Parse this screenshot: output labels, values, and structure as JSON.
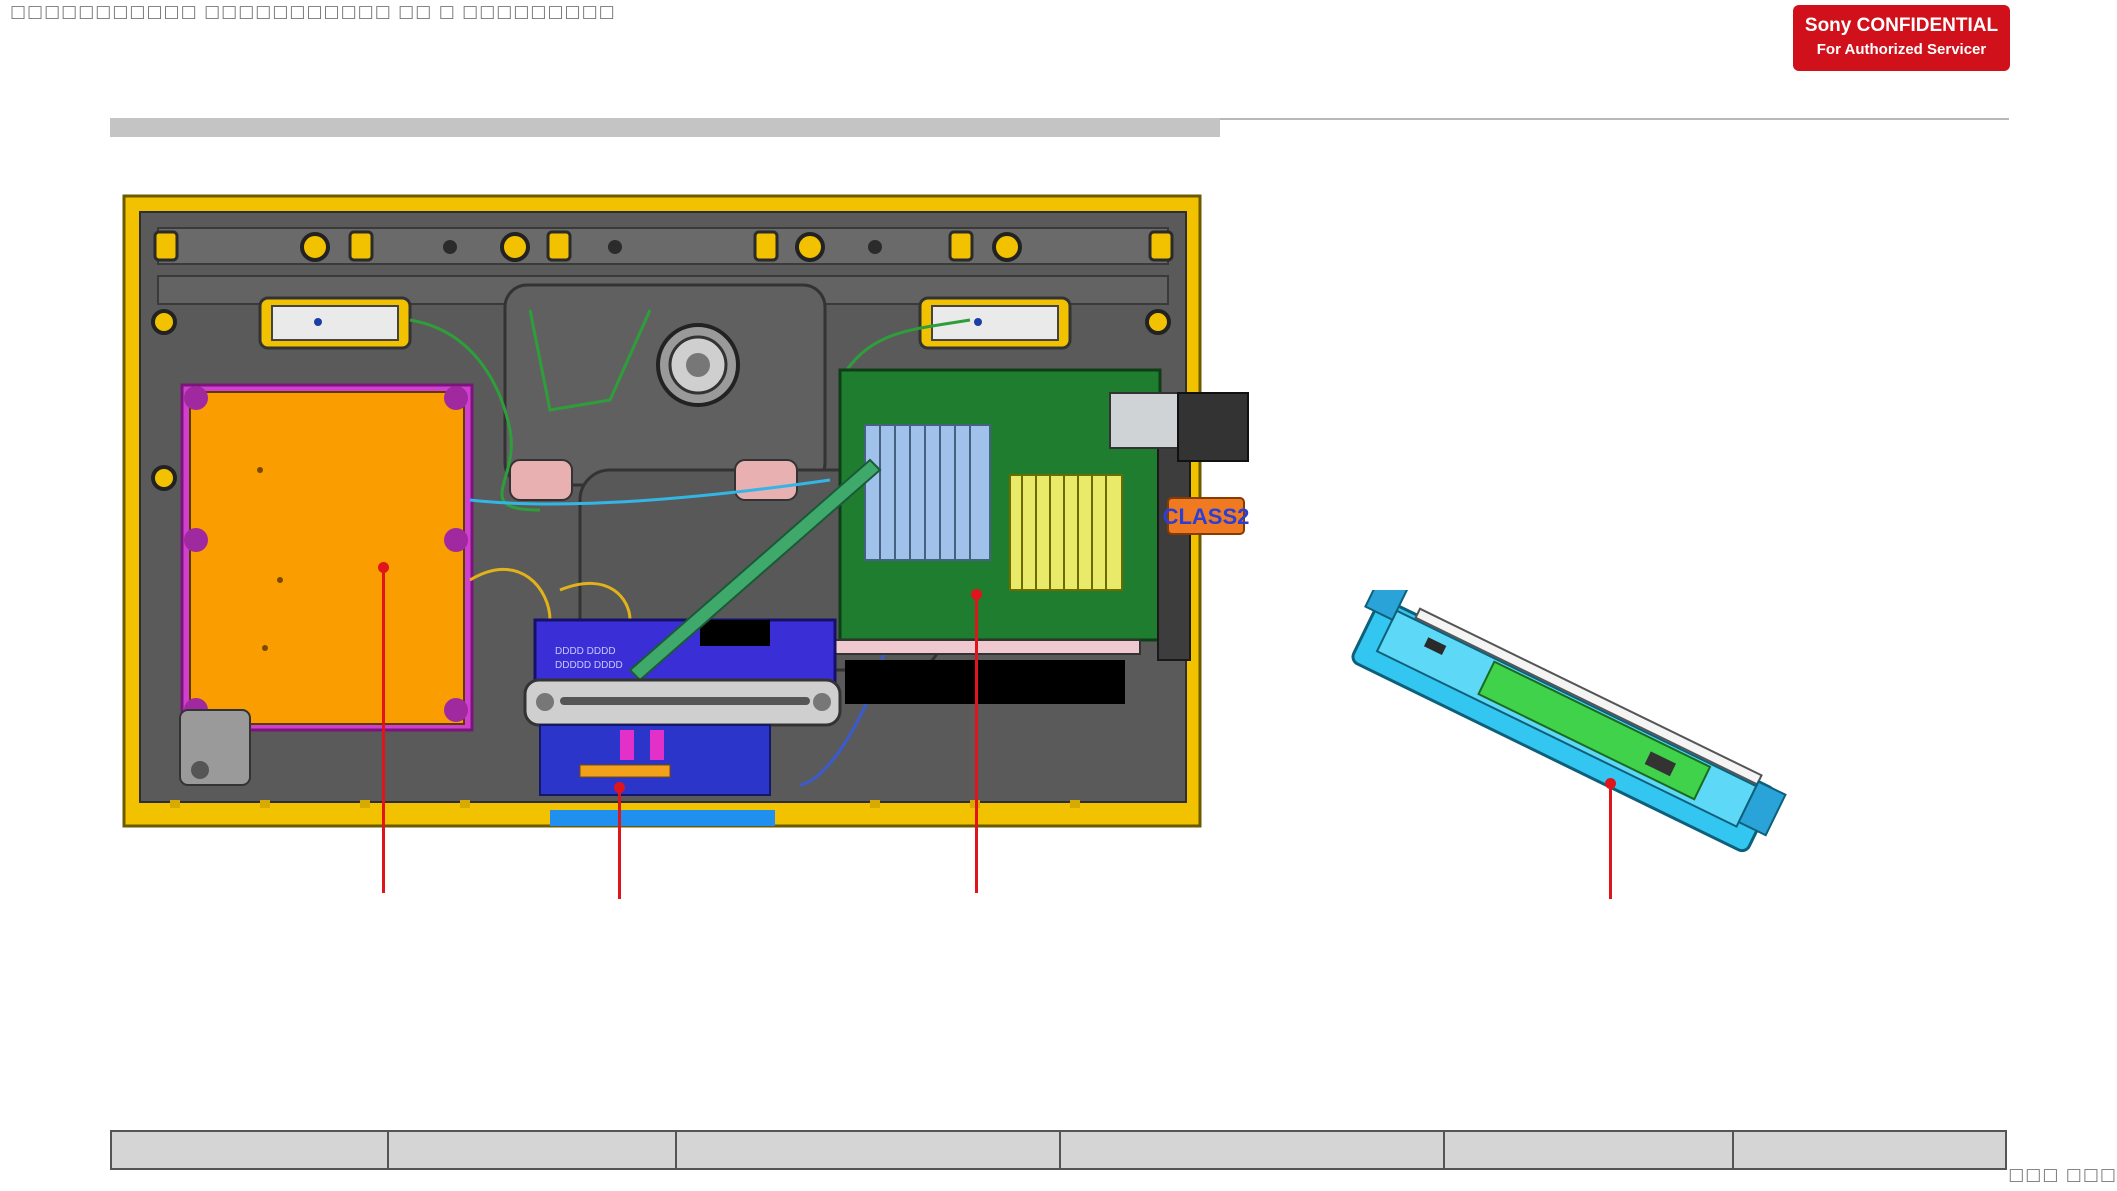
{
  "header": {
    "top_text": "□□□□□□□□□□□ □□□□□□□□□□□ □□ □ □□□□□□□□□",
    "confidential_line1": "Sony CONFIDENTIAL",
    "confidential_line2": "For Authorized Servicer"
  },
  "diagram": {
    "class_label": "CLASS2",
    "board_text_1": "DDDD DDDD",
    "board_text_2": "DDDDD DDDD"
  },
  "footer": {
    "page_number": "□□□ □□□"
  },
  "colors": {
    "badge": "#d0101a",
    "leader_line": "#e0151b",
    "tv_frame": "#f2c200",
    "power_board": "#f99d00",
    "main_board": "#1e7d2e",
    "side_board_housing": "#33c6f0"
  }
}
